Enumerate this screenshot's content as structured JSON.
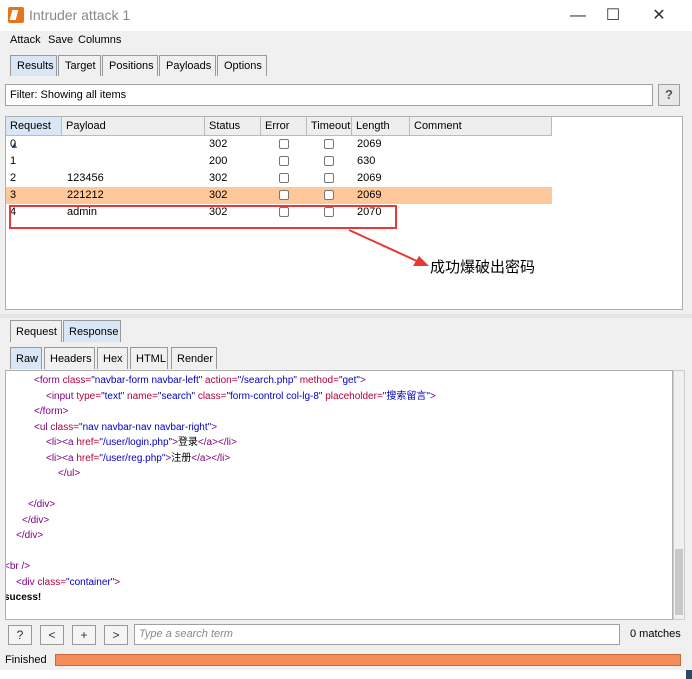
{
  "window": {
    "title": "Intruder attack 1",
    "minimize": "—",
    "maximize": "☐",
    "close": "✕"
  },
  "menu": [
    "Attack",
    "Save",
    "Columns"
  ],
  "tabs": [
    "Results",
    "Target",
    "Positions",
    "Payloads",
    "Options"
  ],
  "filter": {
    "text": "Filter: Showing all items",
    "help": "?"
  },
  "table": {
    "headers": [
      "Request",
      "Payload",
      "Status",
      "Error",
      "Timeout",
      "Length",
      "Comment"
    ],
    "sort_indicator": "▲",
    "rows": [
      {
        "request": "0",
        "payload": "",
        "status": "302",
        "error": false,
        "timeout": false,
        "length": "2069",
        "comment": "",
        "selected": false
      },
      {
        "request": "1",
        "payload": "",
        "status": "200",
        "error": false,
        "timeout": false,
        "length": "630",
        "comment": "",
        "selected": false
      },
      {
        "request": "2",
        "payload": "123456",
        "status": "302",
        "error": false,
        "timeout": false,
        "length": "2069",
        "comment": "",
        "selected": false
      },
      {
        "request": "3",
        "payload": "221212",
        "status": "302",
        "error": false,
        "timeout": false,
        "length": "2069",
        "comment": "",
        "selected": true
      },
      {
        "request": "4",
        "payload": "admin",
        "status": "302",
        "error": false,
        "timeout": false,
        "length": "2070",
        "comment": "",
        "selected": false
      }
    ]
  },
  "annotation": {
    "text": "成功爆破出密码",
    "color": "#e53935"
  },
  "req_resp_tabs": [
    "Request",
    "Response"
  ],
  "view_tabs": [
    "Raw",
    "Headers",
    "Hex",
    "HTML",
    "Render"
  ],
  "code": [
    {
      "indent": 5,
      "parts": [
        [
          "tag",
          "<form "
        ],
        [
          "attr",
          "class="
        ],
        [
          "val",
          "\"navbar-form navbar-left\""
        ],
        [
          "attr",
          " action="
        ],
        [
          "val",
          "\"/search.php\""
        ],
        [
          "attr",
          " method="
        ],
        [
          "val",
          "\"get\""
        ],
        [
          "tag",
          ">"
        ]
      ]
    },
    {
      "indent": 7,
      "parts": [
        [
          "tag",
          "<input "
        ],
        [
          "attr",
          "type="
        ],
        [
          "val",
          "\"text\""
        ],
        [
          "attr",
          " name="
        ],
        [
          "val",
          "\"search\""
        ],
        [
          "attr",
          " class="
        ],
        [
          "val",
          "\"form-control col-lg-8\""
        ],
        [
          "attr",
          " placeholder="
        ],
        [
          "val",
          "\"搜索留言\""
        ],
        [
          "tag",
          ">"
        ]
      ]
    },
    {
      "indent": 5,
      "parts": [
        [
          "tag",
          "</form>"
        ]
      ]
    },
    {
      "indent": 5,
      "parts": [
        [
          "tag",
          "<ul "
        ],
        [
          "attr",
          "class="
        ],
        [
          "val",
          "\"nav navbar-nav navbar-right\""
        ],
        [
          "tag",
          ">"
        ]
      ]
    },
    {
      "indent": 7,
      "parts": [
        [
          "tag",
          "<li><a "
        ],
        [
          "attr",
          "href="
        ],
        [
          "val",
          "\"/user/login.php\""
        ],
        [
          "tag",
          ">"
        ],
        [
          "txt",
          "登录"
        ],
        [
          "tag",
          "</a></li>"
        ]
      ]
    },
    {
      "indent": 7,
      "parts": [
        [
          "tag",
          "<li><a "
        ],
        [
          "attr",
          "href="
        ],
        [
          "val",
          "\"/user/reg.php\""
        ],
        [
          "tag",
          ">"
        ],
        [
          "txt",
          "注册"
        ],
        [
          "tag",
          "</a></li>"
        ]
      ]
    },
    {
      "indent": 9,
      "parts": [
        [
          "tag",
          "</ul>"
        ]
      ]
    },
    {
      "indent": 0,
      "parts": []
    },
    {
      "indent": 4,
      "parts": [
        [
          "tag",
          "</div>"
        ]
      ]
    },
    {
      "indent": 3,
      "parts": [
        [
          "tag",
          "</div>"
        ]
      ]
    },
    {
      "indent": 2,
      "parts": [
        [
          "tag",
          "</div>"
        ]
      ]
    },
    {
      "indent": 0,
      "parts": []
    },
    {
      "indent": 0,
      "parts": [
        [
          "tag",
          "<br />"
        ]
      ]
    },
    {
      "indent": 2,
      "parts": [
        [
          "tag",
          "<div "
        ],
        [
          "attr",
          "class="
        ],
        [
          "val",
          "\"container\""
        ],
        [
          "tag",
          ">"
        ]
      ]
    },
    {
      "indent": 0,
      "parts": [
        [
          "bold",
          "sucess!"
        ]
      ]
    }
  ],
  "search": {
    "placeholder": "Type a search term",
    "matches": "0 matches",
    "buttons": [
      "?",
      "<",
      "+",
      ">"
    ]
  },
  "status": {
    "text": "Finished",
    "progress_fraction": 1.0
  }
}
